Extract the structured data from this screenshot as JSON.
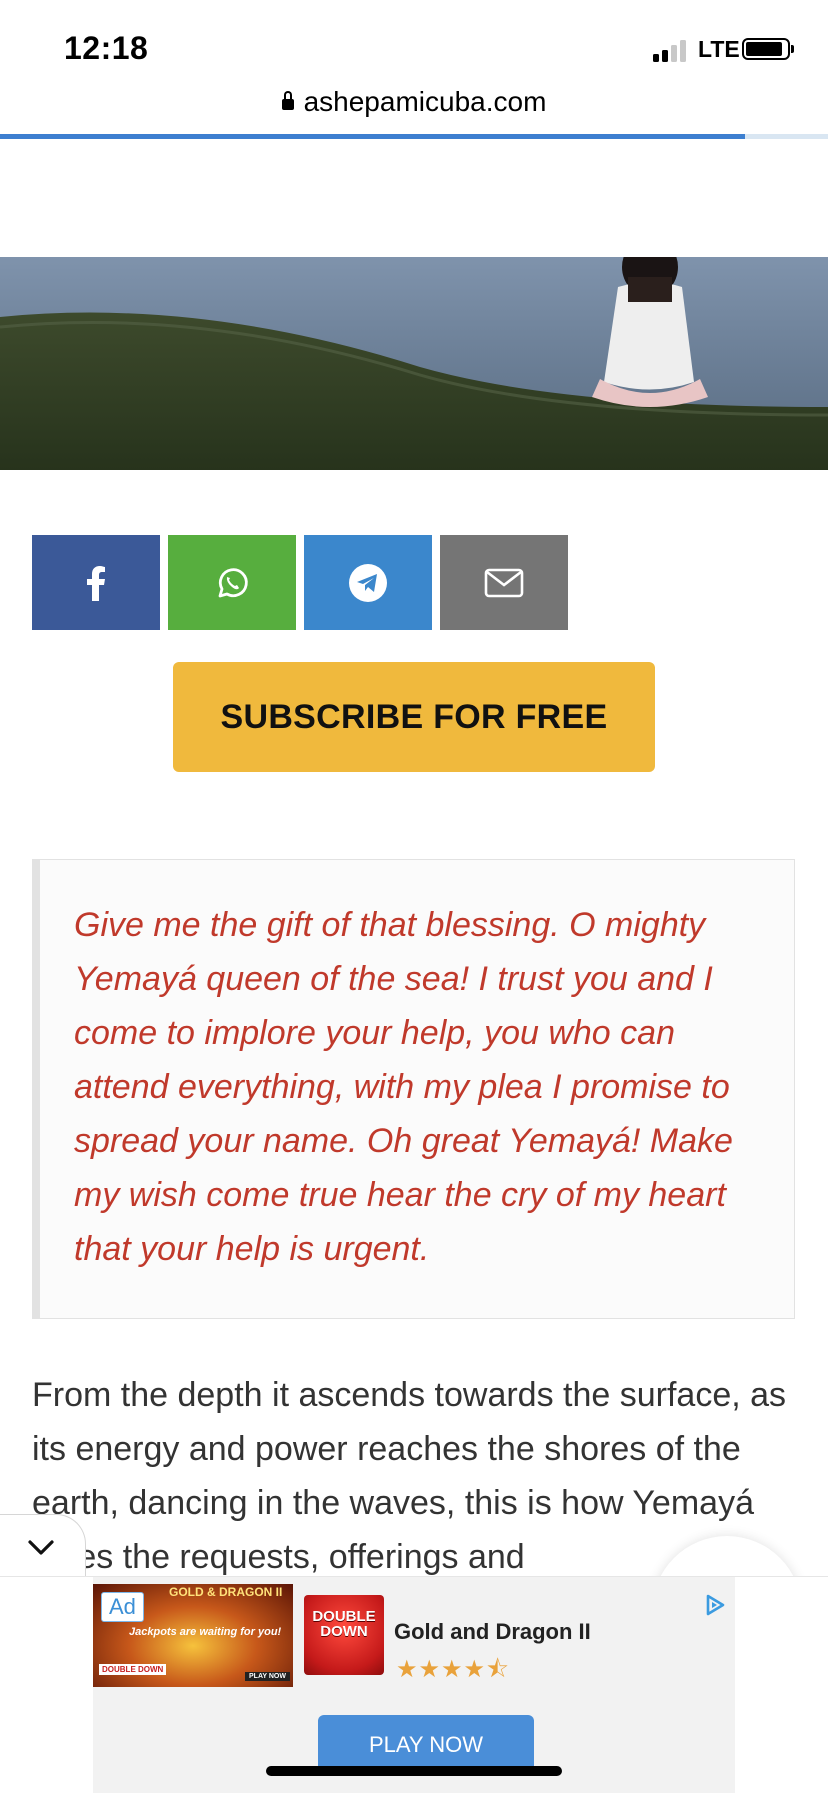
{
  "status_bar": {
    "time": "12:18",
    "network": "LTE"
  },
  "browser": {
    "url": "ashepamicuba.com",
    "load_progress": 0.9
  },
  "share_buttons": [
    {
      "icon": "facebook-icon",
      "color": "#3b5998"
    },
    {
      "icon": "whatsapp-icon",
      "color": "#57ae3e"
    },
    {
      "icon": "telegram-icon",
      "color": "#3b87cc"
    },
    {
      "icon": "envelope-icon",
      "color": "#757575"
    }
  ],
  "subscribe": {
    "label": "SUBSCRIBE FOR FREE",
    "color": "#f0b93d"
  },
  "quote": {
    "text": "Give me the gift of that blessing. O mighty Yemayá queen of the sea! I trust you and I come to implore your help, you who can attend everything, with my plea I promise to spread your name. Oh great Yemayá! Make my wish come true hear the cry of my heart that your help is urgent.",
    "color": "#c0392b"
  },
  "article": {
    "paragraph": "From the depth it ascends towards the surface, as its energy and power reaches the shores of the earth, dancing in the waves, this is how Yemayá takes the requests, offerings and"
  },
  "ad": {
    "badge": "Ad",
    "banner_tagline": "Jackpots are waiting for you!",
    "banner_logo": "GOLD & DRAGON II",
    "banner_corner": "DOUBLE DOWN",
    "banner_play": "PLAY NOW",
    "app_icon_text": "DOUBLE DOWN",
    "title": "Gold and Dragon II",
    "rating": 4.5,
    "cta": "PLAY NOW"
  }
}
